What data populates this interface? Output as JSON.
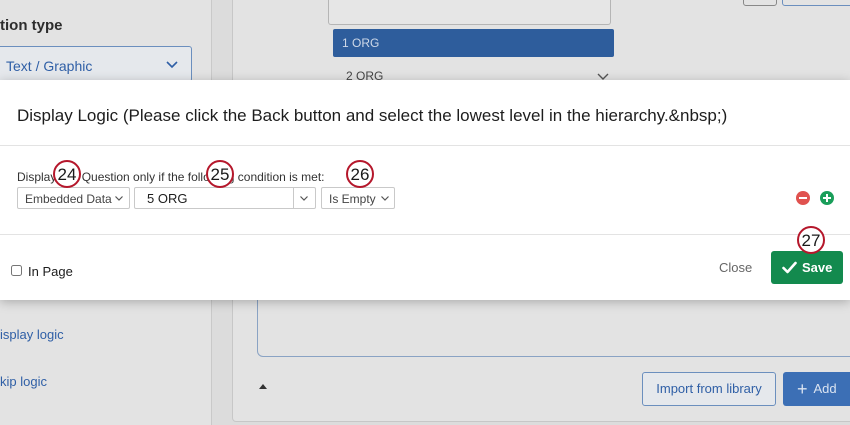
{
  "background": {
    "section_title": "tion type",
    "question_type_select": "Text / Graphic",
    "links": [
      "isplay logic",
      "kip logic"
    ],
    "list": {
      "selected_item": "1 ORG",
      "next_item": "2 ORG"
    },
    "import_button": "Import from library",
    "add_button": "Add"
  },
  "modal": {
    "title": "Display Logic (Please click the Back button and select the lowest level in the hierarchy.&nbsp;)",
    "condition_text": "Display this Question only if the following condition is met:",
    "condition": {
      "source": "Embedded Data",
      "field_value": "5 ORG",
      "operator": "Is Empty"
    },
    "in_page_label": "In Page",
    "in_page_checked": false,
    "close_label": "Close",
    "save_label": "Save"
  },
  "callouts": [
    "24",
    "25",
    "26",
    "27"
  ],
  "colors": {
    "save_green": "#138a4e",
    "remove_red": "#e0524f",
    "add_green": "#1a9e5a",
    "selected_blue": "#2e5d9c",
    "callout_red": "#b5172b"
  },
  "icons": [
    "chevron-down-icon",
    "remove-condition-icon",
    "add-condition-icon",
    "checkmark-icon",
    "plus-icon",
    "caret-up-icon"
  ]
}
